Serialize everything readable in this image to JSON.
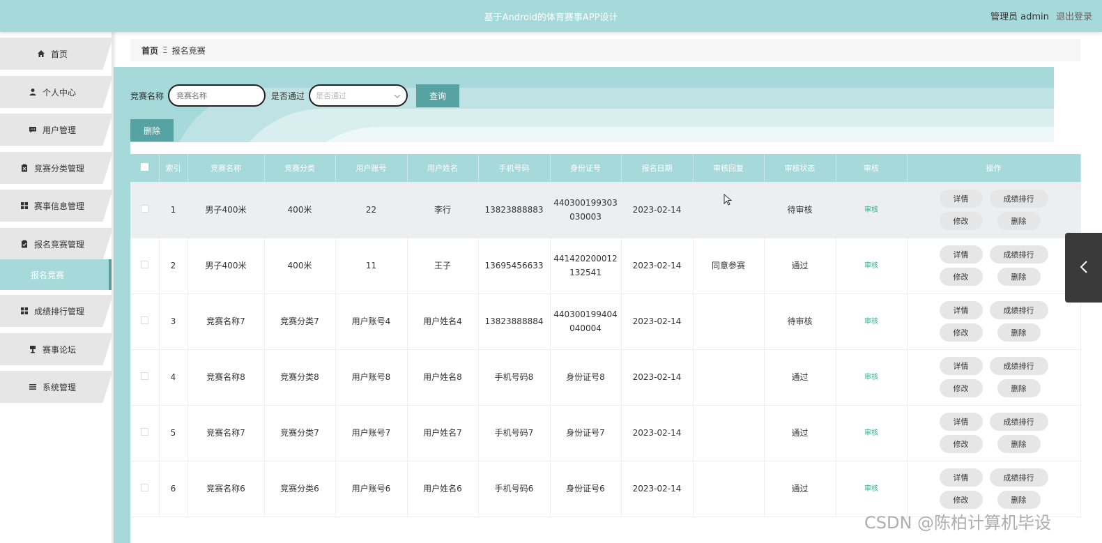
{
  "header": {
    "title": "基于Android的体育赛事APP设计",
    "role_user": "管理员 admin",
    "logout": "退出登录"
  },
  "sidebar": {
    "items": [
      {
        "label": "首页",
        "icon": "home-icon"
      },
      {
        "label": "个人中心",
        "icon": "user-icon"
      },
      {
        "label": "用户管理",
        "icon": "chat-icon"
      },
      {
        "label": "竞赛分类管理",
        "icon": "clipboard-x-icon"
      },
      {
        "label": "赛事信息管理",
        "icon": "grid-icon"
      },
      {
        "label": "报名竞赛管理",
        "icon": "clipboard-check-icon"
      },
      {
        "label": "成绩排行管理",
        "icon": "grid-icon"
      },
      {
        "label": "赛事论坛",
        "icon": "podium-icon"
      },
      {
        "label": "系统管理",
        "icon": "menu-icon"
      }
    ],
    "active_sub": "报名竞赛"
  },
  "breadcrumb": {
    "home": "首页",
    "sep": "Ξ",
    "current": "报名竞赛"
  },
  "search": {
    "name_label": "竞赛名称",
    "name_placeholder": "竞赛名称",
    "pass_label": "是否通过",
    "pass_placeholder": "是否通过",
    "query_button": "查询",
    "delete_button": "删除"
  },
  "table": {
    "columns": [
      "索引",
      "竞赛名称",
      "竞赛分类",
      "用户账号",
      "用户姓名",
      "手机号码",
      "身份证号",
      "报名日期",
      "审核回复",
      "审核状态",
      "审核",
      "操作"
    ],
    "rows": [
      {
        "index": "1",
        "name": "男子400米",
        "category": "400米",
        "account": "22",
        "username": "李行",
        "phone": "13823888883",
        "id_card": "440300199303\n030003",
        "date": "2023-02-14",
        "reply": "",
        "status": "待审核",
        "audit": "审核"
      },
      {
        "index": "2",
        "name": "男子400米",
        "category": "400米",
        "account": "11",
        "username": "王子",
        "phone": "13695456633",
        "id_card": "441420200012\n132541",
        "date": "2023-02-14",
        "reply": "同意参赛",
        "status": "通过",
        "audit": "审核"
      },
      {
        "index": "3",
        "name": "竞赛名称7",
        "category": "竞赛分类7",
        "account": "用户账号4",
        "username": "用户姓名4",
        "phone": "13823888884",
        "id_card": "440300199404\n040004",
        "date": "2023-02-14",
        "reply": "",
        "status": "待审核",
        "audit": "审核"
      },
      {
        "index": "4",
        "name": "竞赛名称8",
        "category": "竞赛分类8",
        "account": "用户账号8",
        "username": "用户姓名8",
        "phone": "手机号码8",
        "id_card": "身份证号8",
        "date": "2023-02-14",
        "reply": "",
        "status": "通过",
        "audit": "审核"
      },
      {
        "index": "5",
        "name": "竞赛名称7",
        "category": "竞赛分类7",
        "account": "用户账号7",
        "username": "用户姓名7",
        "phone": "手机号码7",
        "id_card": "身份证号7",
        "date": "2023-02-14",
        "reply": "",
        "status": "通过",
        "audit": "审核"
      },
      {
        "index": "6",
        "name": "竞赛名称6",
        "category": "竞赛分类6",
        "account": "用户账号6",
        "username": "用户姓名6",
        "phone": "手机号码6",
        "id_card": "身份证号6",
        "date": "2023-02-14",
        "reply": "",
        "status": "通过",
        "audit": "审核"
      }
    ],
    "ops": {
      "detail": "详情",
      "ranking": "成绩排行",
      "edit": "修改",
      "delete": "删除"
    }
  },
  "watermark": "CSDN @陈柏计算机毕设",
  "colors": {
    "header": "#a6d9da",
    "button": "#57a2a2",
    "sidebar_item": "#e6e6e6"
  }
}
